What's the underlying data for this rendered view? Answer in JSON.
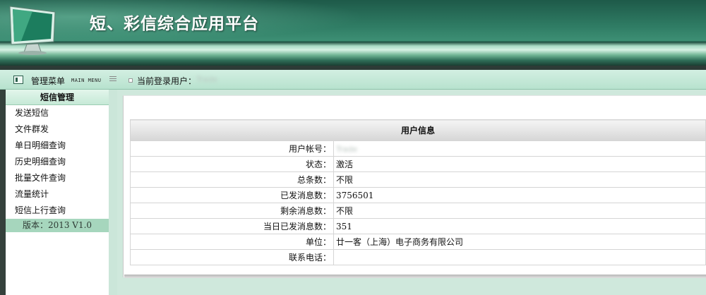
{
  "header": {
    "title": "短、彩信综合应用平台",
    "icon": "monitor-icon"
  },
  "toolbar": {
    "menu_title": "管理菜单",
    "menu_subtitle": "MAIN MENU",
    "current_user_label": "当前登录用户：",
    "current_user_value": "Trade"
  },
  "sidebar": {
    "section_title": "短信管理",
    "items": [
      {
        "label": "发送短信"
      },
      {
        "label": "文件群发"
      },
      {
        "label": "单日明细查询"
      },
      {
        "label": "历史明细查询"
      },
      {
        "label": "批量文件查询"
      },
      {
        "label": "流量统计"
      },
      {
        "label": "短信上行查询"
      }
    ],
    "version": "版本：2013 V1.0"
  },
  "user_info": {
    "heading": "用户信息",
    "rows": [
      {
        "label": "用户帐号：",
        "value": "Trade"
      },
      {
        "label": "状态：",
        "value": "激活"
      },
      {
        "label": "总条数：",
        "value": "不限"
      },
      {
        "label": "已发消息数：",
        "value": "3756501"
      },
      {
        "label": "剩余消息数：",
        "value": "不限"
      },
      {
        "label": "当日已发消息数：",
        "value": "351"
      },
      {
        "label": "单位：",
        "value": "廿一客（上海）电子商务有限公司"
      },
      {
        "label": "联系电话：",
        "value": ""
      }
    ]
  },
  "colors": {
    "banner": "#2f7c64",
    "sidebar_head": "#c6e9d7",
    "version_bar": "#a6d6bd"
  }
}
